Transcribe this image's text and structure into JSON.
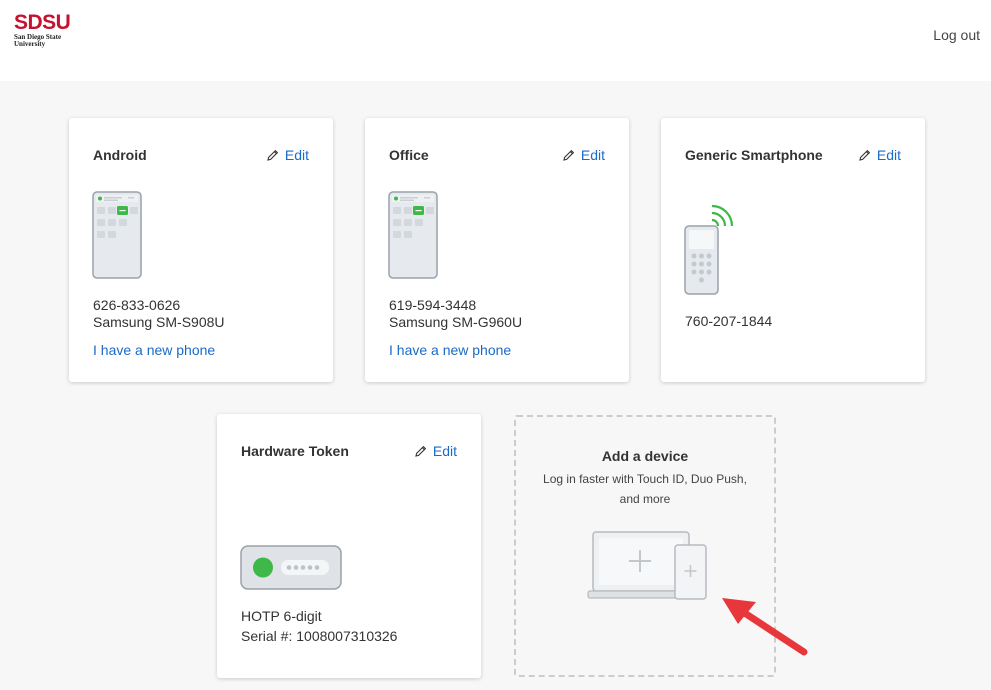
{
  "header": {
    "logo_main": "SDSU",
    "logo_sub_line1": "San Diego State",
    "logo_sub_line2": "University",
    "logout_label": "Log out"
  },
  "devices": [
    {
      "name": "Android",
      "edit_label": "Edit",
      "phone": "626-833-0626",
      "model": "Samsung SM-S908U",
      "link": "I have a new phone",
      "icon": "smartphone-icon"
    },
    {
      "name": "Office",
      "edit_label": "Edit",
      "phone": "619-594-3448",
      "model": "Samsung SM-G960U",
      "link": "I have a new phone",
      "icon": "smartphone-icon"
    },
    {
      "name": "Generic Smartphone",
      "edit_label": "Edit",
      "phone": "760-207-1844",
      "icon": "phone-signal-icon"
    },
    {
      "name": "Hardware Token",
      "edit_label": "Edit",
      "token_type": "HOTP 6-digit",
      "serial": "Serial #: 1008007310326",
      "icon": "hardware-token-icon"
    }
  ],
  "add_device": {
    "title": "Add a device",
    "description": "Log in faster with Touch ID, Duo Push, and more",
    "icon": "add-device-icon"
  },
  "colors": {
    "brand": "#c41230",
    "link": "#1a6bc8",
    "accent_green": "#3db849",
    "arrow": "#e8373b"
  }
}
